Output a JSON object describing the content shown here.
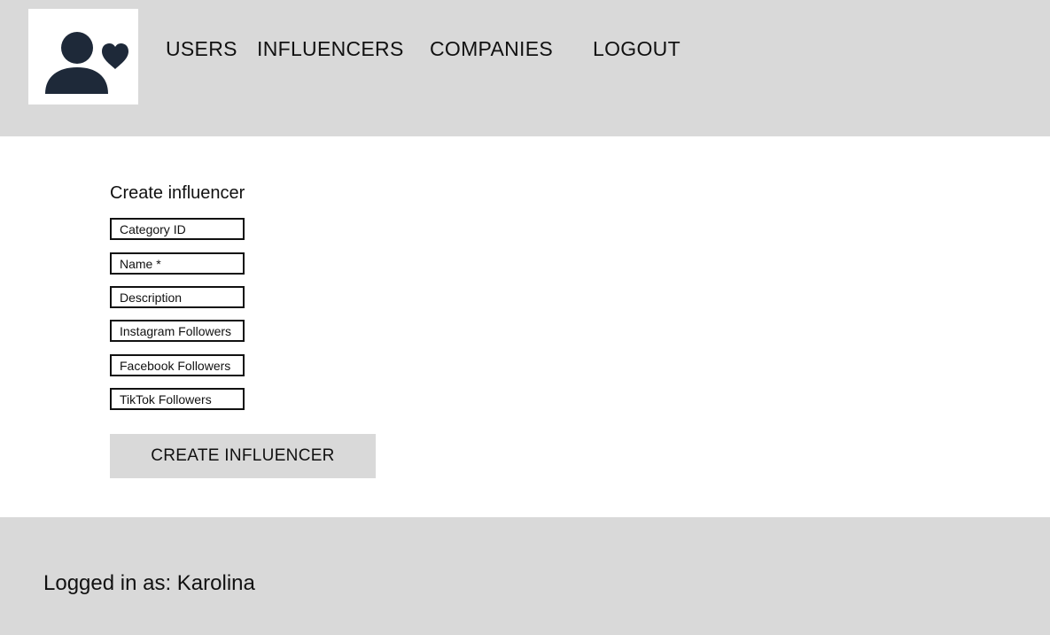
{
  "header": {
    "logo_icon": "user-heart-icon",
    "nav": {
      "users": "USERS",
      "influencers": "INFLUENCERS",
      "companies": "COMPANIES",
      "logout": "LOGOUT"
    }
  },
  "form": {
    "title": "Create influencer",
    "fields": {
      "category_id": {
        "placeholder": "Category ID",
        "value": ""
      },
      "name": {
        "placeholder": "Name *",
        "value": ""
      },
      "description": {
        "placeholder": "Description",
        "value": ""
      },
      "instagram_followers": {
        "placeholder": "Instagram Followers",
        "value": ""
      },
      "facebook_followers": {
        "placeholder": "Facebook Followers",
        "value": ""
      },
      "tiktok_followers": {
        "placeholder": "TikTok Followers",
        "value": ""
      }
    },
    "submit_label": "CREATE INFLUENCER"
  },
  "footer": {
    "logged_in_text": "Logged in as: Karolina"
  },
  "colors": {
    "header_bg": "#d9d9d9",
    "footer_bg": "#d9d9d9",
    "button_bg": "#d9d9d9",
    "icon_fill": "#1e2939"
  }
}
